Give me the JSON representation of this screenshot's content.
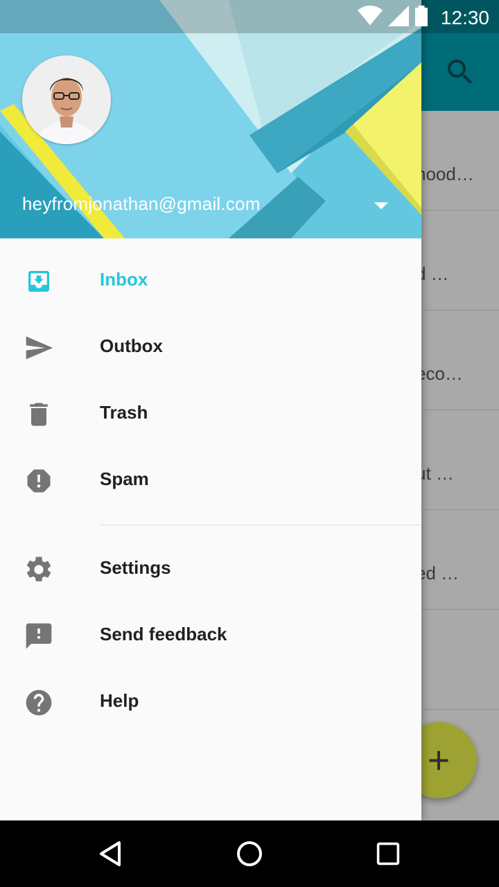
{
  "status_bar": {
    "time": "12:30",
    "icons": [
      "wifi-icon",
      "signal-icon",
      "battery-icon"
    ]
  },
  "background_app": {
    "toolbar_icon": "search-icon",
    "snippets": [
      "hood…",
      "d …",
      "eco…",
      "ut …",
      "ed …"
    ],
    "fab_label": "+",
    "accent": "#00a0b0",
    "fab_color": "#e9ef4a"
  },
  "drawer": {
    "account": {
      "email": "heyfromjonathan@gmail.com"
    },
    "primary_items": [
      {
        "label": "Inbox",
        "icon": "inbox-icon",
        "active": true
      },
      {
        "label": "Outbox",
        "icon": "send-icon",
        "active": false
      },
      {
        "label": "Trash",
        "icon": "trash-icon",
        "active": false
      },
      {
        "label": "Spam",
        "icon": "spam-icon",
        "active": false
      }
    ],
    "secondary_items": [
      {
        "label": "Settings",
        "icon": "gear-icon"
      },
      {
        "label": "Send feedback",
        "icon": "feedback-icon"
      },
      {
        "label": "Help",
        "icon": "help-icon"
      }
    ],
    "active_color": "#26c6da"
  },
  "nav_bar": {
    "buttons": [
      "back-icon",
      "home-icon",
      "recents-icon"
    ]
  }
}
